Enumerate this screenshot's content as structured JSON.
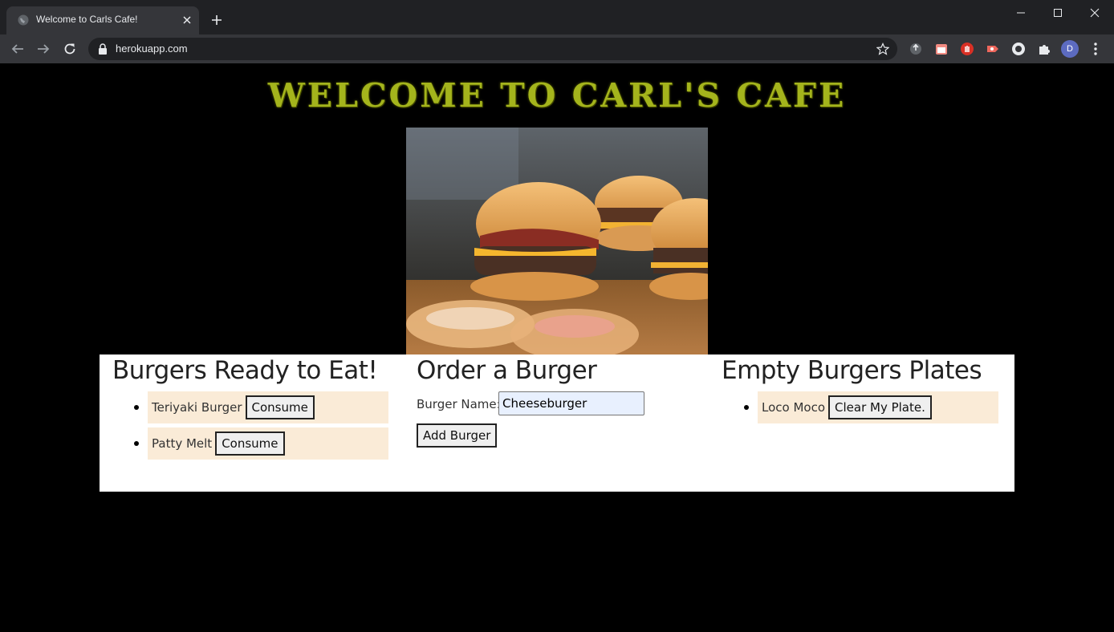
{
  "browser": {
    "tab_title": "Welcome to Carls Cafe!",
    "url": "herokuapp.com",
    "profile_initial": "D"
  },
  "page": {
    "headline": "WELCOME TO CARL'S CAFE",
    "ready": {
      "heading": "Burgers Ready to Eat!",
      "items": [
        {
          "name": "Teriyaki Burger",
          "button": "Consume"
        },
        {
          "name": "Patty Melt",
          "button": "Consume"
        }
      ]
    },
    "order": {
      "heading": "Order a Burger",
      "label": "Burger Name:",
      "input_value": "Cheeseburger",
      "button": "Add Burger"
    },
    "empty": {
      "heading": "Empty Burgers Plates",
      "items": [
        {
          "name": "Loco Moco",
          "button": "Clear My Plate."
        }
      ]
    }
  },
  "colors": {
    "headline": "#a4b41c",
    "item_background": "#faebd7",
    "panel_background": "#ffffff",
    "page_background": "#000000"
  }
}
